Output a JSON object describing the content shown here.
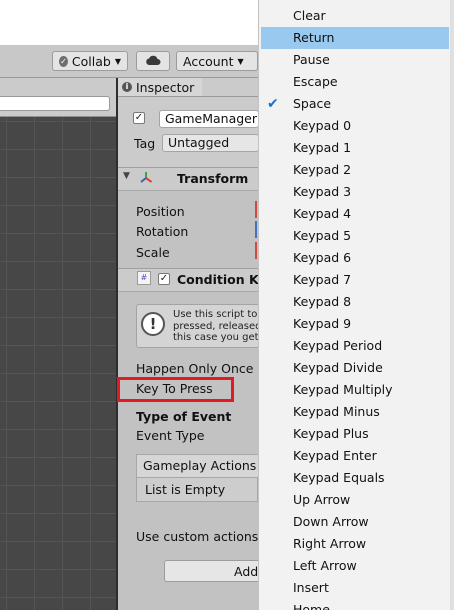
{
  "toolbar": {
    "collab_label": "Collab",
    "account_label": "Account"
  },
  "inspector": {
    "tab_label": "Inspector",
    "object_name": "GameManager",
    "tag_label": "Tag",
    "tag_value": "Untagged",
    "transform": {
      "title": "Transform",
      "position_label": "Position",
      "rotation_label": "Rotation",
      "scale_label": "Scale"
    },
    "condition": {
      "title": "Condition Key",
      "help_lines": [
        "Use this script to p",
        "pressed, released",
        "this case you get"
      ],
      "happen_only_once_label": "Happen Only Once",
      "key_to_press_label": "Key To Press",
      "type_of_event_label": "Type of Event",
      "event_type_label": "Event Type",
      "gameplay_actions_label": "Gameplay Actions",
      "list_empty_label": "List is Empty",
      "use_custom_actions_label": "Use custom actions",
      "add_button_label": "Add"
    }
  },
  "dropdown": {
    "selected": "Space",
    "highlighted": "Return",
    "options": [
      "Clear",
      "Return",
      "Pause",
      "Escape",
      "Space",
      "Keypad 0",
      "Keypad 1",
      "Keypad 2",
      "Keypad 3",
      "Keypad 4",
      "Keypad 5",
      "Keypad 6",
      "Keypad 7",
      "Keypad 8",
      "Keypad 9",
      "Keypad Period",
      "Keypad Divide",
      "Keypad Multiply",
      "Keypad Minus",
      "Keypad Plus",
      "Keypad Enter",
      "Keypad Equals",
      "Up Arrow",
      "Down Arrow",
      "Right Arrow",
      "Left Arrow",
      "Insert",
      "Home"
    ]
  },
  "colors": {
    "highlight": "#99c9ef",
    "annotation_red": "#e21b23",
    "check_blue": "#1f6fc6"
  }
}
